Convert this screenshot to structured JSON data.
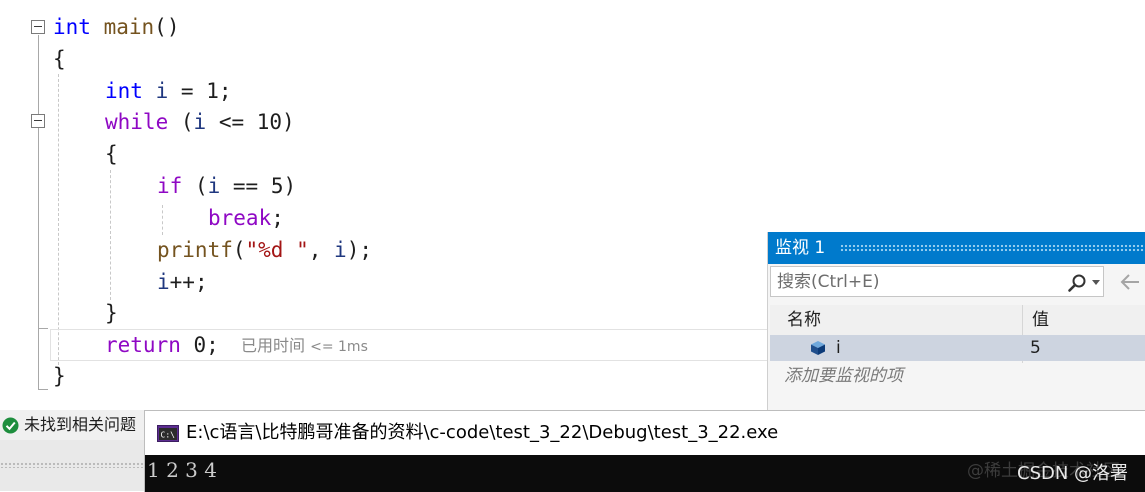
{
  "editor": {
    "code": {
      "l1": {
        "kw": "int",
        "fn": "main",
        "rest": "()"
      },
      "l2": "{",
      "l3": {
        "kw": "int",
        "var": "i",
        "op": " = ",
        "num": "1",
        "end": ";"
      },
      "l4": {
        "kw": "while",
        "open": " (",
        "var": "i",
        "op": " <= ",
        "num": "10",
        "close": ")"
      },
      "l5": "{",
      "l6": {
        "kw": "if",
        "open": " (",
        "var": "i",
        "op": " == ",
        "num": "5",
        "close": ")"
      },
      "l7": {
        "kw": "break",
        "end": ";"
      },
      "l8": {
        "fn": "printf",
        "open": "(",
        "str": "\"%d \"",
        "sep": ", ",
        "var": "i",
        "close": ");"
      },
      "l9": {
        "var": "i",
        "end": "++;"
      },
      "l10": "}",
      "l11": {
        "kw": "return",
        "num": "0",
        "end": ";"
      },
      "l12": "}"
    },
    "elapsed_label": "已用时间",
    "elapsed_value": "<= 1ms"
  },
  "watch": {
    "title": "监视 1",
    "search_placeholder": "搜索(Ctrl+E)",
    "col_name": "名称",
    "col_value": "值",
    "rows": [
      {
        "name": "i",
        "value": "5"
      }
    ],
    "add_item": "添加要监视的项"
  },
  "status": {
    "text": "未找到相关问题"
  },
  "console": {
    "title": "E:\\c语言\\比特鹏哥准备的资料\\c-code\\test_3_22\\Debug\\test_3_22.exe",
    "output": "1 2 3 4"
  },
  "watermark": {
    "faint": "@稀土掘金技术社区",
    "text": "CSDN @洛署"
  },
  "colors": {
    "accent": "#007acc",
    "keyword": "#0000ff",
    "control": "#8f08c4",
    "function": "#74531f",
    "string": "#a31515",
    "variable": "#1f377f",
    "number": "#098658",
    "success": "#1e8e3e"
  }
}
